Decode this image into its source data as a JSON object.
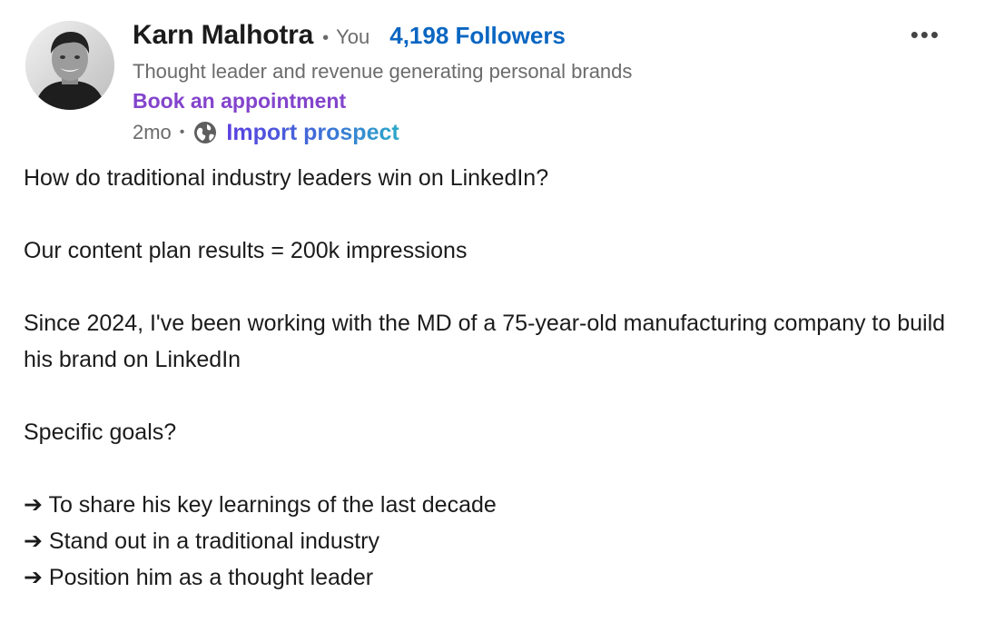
{
  "author": {
    "name": "Karn Malhotra",
    "relation": "You",
    "followers": "4,198 Followers",
    "headline": "Thought leader and revenue generating personal brands",
    "cta": "Book an appointment",
    "avatar": "profile-photo"
  },
  "meta": {
    "age": "2mo",
    "separator": "•",
    "visibility_icon": "globe-icon",
    "action": "Import prospect"
  },
  "menu": {
    "label": "•••"
  },
  "post": {
    "paragraphs": [
      "How do traditional industry leaders win on LinkedIn?",
      "Our content plan results = 200k impressions",
      "Since 2024, I've been working with the MD of a 75-year-old manufacturing company to build his brand on LinkedIn",
      "Specific goals?"
    ],
    "bullets": [
      "➔ To share his key learnings of the last decade",
      "➔ Stand out in a traditional industry",
      "➔ Position him as a thought leader"
    ]
  },
  "colors": {
    "followers": "#0a66c2",
    "appointment": "#8344cc",
    "import_start": "#5b3fe0",
    "import_end": "#2aa8c8",
    "muted": "#6b6b6b"
  }
}
